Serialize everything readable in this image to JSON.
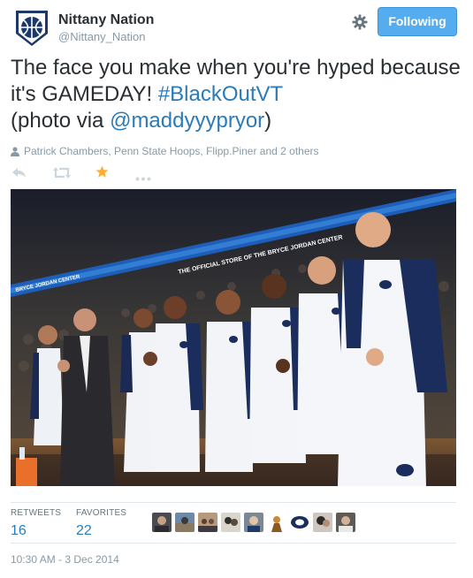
{
  "user": {
    "display_name": "Nittany Nation",
    "handle": "@Nittany_Nation",
    "avatar_icon": "penn-state-basketball-logo"
  },
  "header": {
    "settings_icon": "gear-icon",
    "follow_label": "Following",
    "follow_color": "#55acee"
  },
  "tweet": {
    "text_part1": "The face you make when you're hyped because it's GAMEDAY! ",
    "hashtag": "#BlackOutVT",
    "text_part2": "(photo via ",
    "mention": "@maddyyypryor",
    "text_part3": ")"
  },
  "retweeted_by": "Patrick Chambers, Penn State Hoops, Flipp.Piner and 2 others",
  "actions": {
    "reply_icon": "reply-icon",
    "retweet_icon": "retweet-icon",
    "favorite_icon": "star-icon",
    "favorite_color": "#ffac33",
    "more_icon": "more-icon"
  },
  "photo": {
    "banner_text": "THE OFFICIAL STORE OF THE BRYCE JORDAN CENTER",
    "banner_text2": "BRYCE JORDAN CENTER"
  },
  "stats": {
    "retweets_label": "RETWEETS",
    "retweets_count": "16",
    "favorites_label": "FAVORITES",
    "favorites_count": "22"
  },
  "favorited_by_avatars": 9,
  "timestamp": "10:30 AM - 3 Dec 2014",
  "colors": {
    "link": "#2b7bb9",
    "muted": "#8899a6",
    "text": "#292f33"
  }
}
